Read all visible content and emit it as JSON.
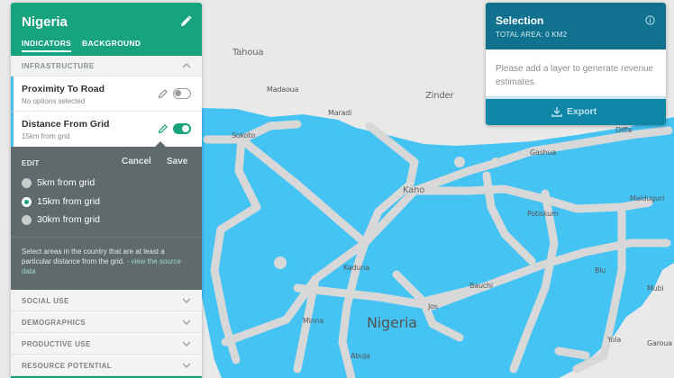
{
  "map": {
    "country_label": "Nigeria",
    "colors": {
      "land": "#e8e8e8",
      "country": "#45c3f3",
      "roads": "#d9d9d9"
    },
    "places": [
      {
        "name": "Tahoua"
      },
      {
        "name": "Madaoua"
      },
      {
        "name": "Maradi"
      },
      {
        "name": "Zinder"
      },
      {
        "name": "Sokoto"
      },
      {
        "name": "Gashua"
      },
      {
        "name": "Diffa"
      },
      {
        "name": "Kano"
      },
      {
        "name": "Potiskum"
      },
      {
        "name": "Maiduguri"
      },
      {
        "name": "Kaduna"
      },
      {
        "name": "Bauchi"
      },
      {
        "name": "Blu"
      },
      {
        "name": "Mubi"
      },
      {
        "name": "Jos"
      },
      {
        "name": "Minna"
      },
      {
        "name": "Yola"
      },
      {
        "name": "Garoua"
      },
      {
        "name": "Abuja"
      }
    ]
  },
  "panel": {
    "title": "Nigeria",
    "tabs": [
      "INDICATORS",
      "BACKGROUND"
    ],
    "active_tab": "INDICATORS",
    "section_title": "INFRASTRUCTURE",
    "indicators": [
      {
        "name": "Proximity To Road",
        "subtitle": "No options selected",
        "enabled": false
      },
      {
        "name": "Distance From Grid",
        "subtitle": "15km from grid",
        "enabled": true
      }
    ],
    "edit": {
      "label": "EDIT",
      "cancel": "Cancel",
      "save": "Save",
      "options": [
        "5km from grid",
        "15km from grid",
        "30km from grid"
      ],
      "selected_option": "15km from grid",
      "description": "Select areas in the country that are at least a particular distance from the grid.",
      "link_text": "- view the source data"
    },
    "categories": [
      "SOCIAL USE",
      "DEMOGRAPHICS",
      "PRODUCTIVE USE",
      "RESOURCE POTENTIAL"
    ],
    "colors": {
      "header": "#16a37e",
      "edit_bg": "#5f6a6d"
    }
  },
  "selection": {
    "title": "Selection",
    "total_area": "TOTAL AREA: 0 KM2",
    "message": "Please add a layer to generate revenue estimates.",
    "export_label": "Export",
    "colors": {
      "header": "#10728f",
      "footer": "#0f86a6"
    }
  }
}
